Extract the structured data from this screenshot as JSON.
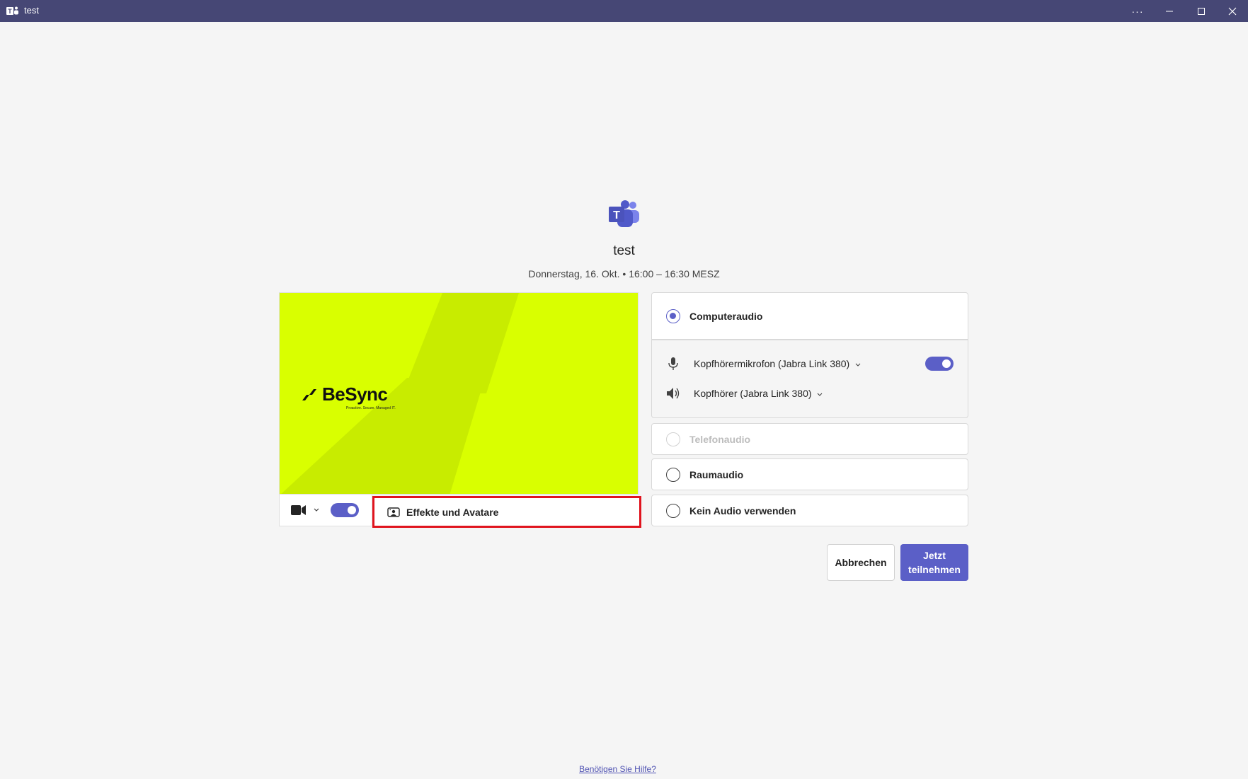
{
  "window": {
    "title": "test",
    "more_glyph": "···",
    "minimize_glyph": "—",
    "maximize_glyph": "☐",
    "close_glyph": "✕"
  },
  "meeting": {
    "title": "test",
    "time": "Donnerstag, 16. Okt. • 16:00 – 16:30 MESZ"
  },
  "video": {
    "brand_name": "BeSync",
    "brand_tagline": "Proactive. Secure. Managed IT.",
    "background_color": "#d9ff00",
    "camera_on": true,
    "effects_label": "Effekte und Avatare"
  },
  "audio": {
    "computer_audio_label": "Computeraudio",
    "computer_audio_selected": true,
    "microphone_label": "Kopfhörermikrofon (Jabra Link 380)",
    "microphone_on": true,
    "speaker_label": "Kopfhörer (Jabra Link 380)",
    "phone_audio_label": "Telefonaudio",
    "room_audio_label": "Raumaudio",
    "no_audio_label": "Kein Audio verwenden"
  },
  "actions": {
    "cancel_label": "Abbrechen",
    "join_label": "Jetzt teilnehmen"
  },
  "help_link": "Benötigen Sie Hilfe?",
  "colors": {
    "titlebar": "#464775",
    "accent": "#5b5fc7",
    "highlight_border": "#e0141e"
  }
}
